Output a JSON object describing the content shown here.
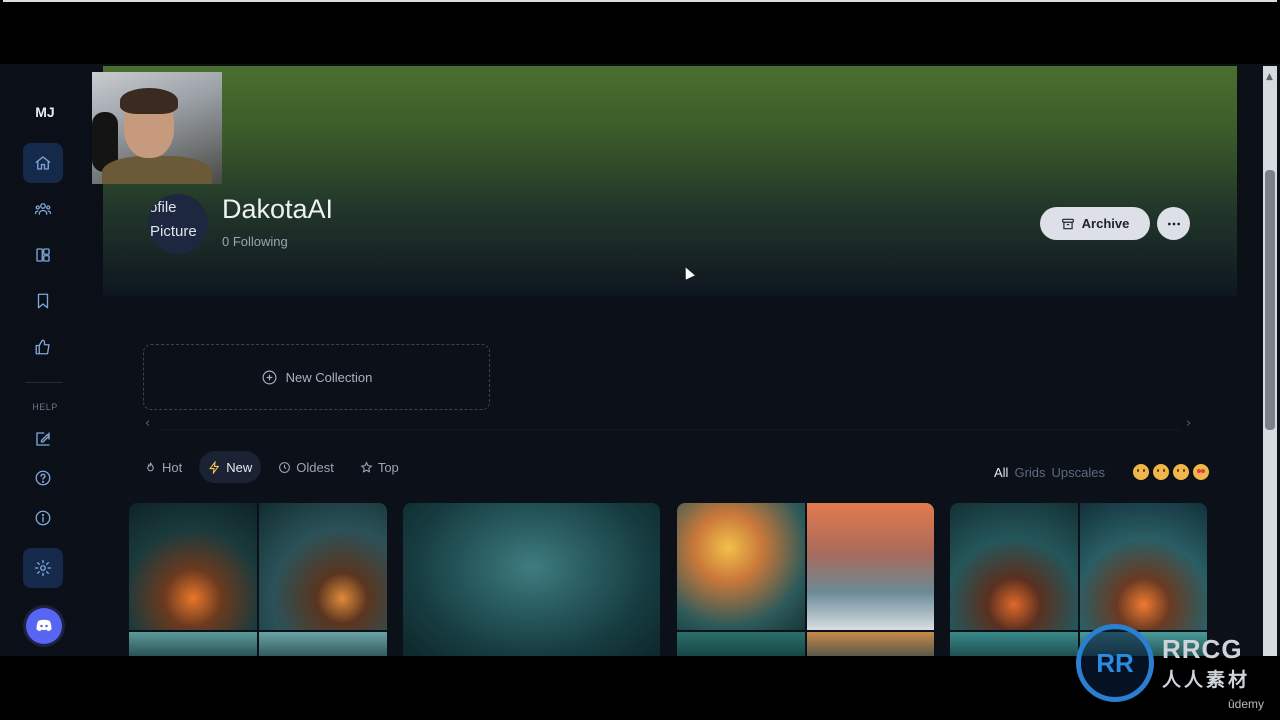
{
  "sidebar": {
    "logo": "MJ",
    "help_label": "HELP",
    "nav_items": [
      {
        "icon": "home-icon",
        "active": true
      },
      {
        "icon": "community-icon"
      },
      {
        "icon": "layout-icon"
      },
      {
        "icon": "bookmark-icon"
      },
      {
        "icon": "thumbs-up-icon"
      }
    ],
    "help_items": [
      {
        "icon": "edit-icon"
      },
      {
        "icon": "help-icon"
      },
      {
        "icon": "info-icon"
      },
      {
        "icon": "settings-icon"
      }
    ],
    "discord_icon": "discord-icon"
  },
  "profile": {
    "avatar_text_line1": "rofile",
    "avatar_text_line2": "Picture",
    "username": "DakotaAI",
    "following": "0 Following",
    "archive_label": "Archive"
  },
  "collections": {
    "new_collection_label": "New Collection"
  },
  "filters": {
    "sort_options": [
      {
        "label": "Hot",
        "icon": "fire-icon"
      },
      {
        "label": "New",
        "icon": "bolt-icon",
        "active": true
      },
      {
        "label": "Oldest",
        "icon": "clock-icon"
      },
      {
        "label": "Top",
        "icon": "star-icon"
      }
    ],
    "view_options": [
      "All",
      "Grids",
      "Upscales"
    ],
    "selected_view": "All"
  },
  "watermark": {
    "logo_text": "RR",
    "line1": "RRCG",
    "line2": "人人素材",
    "udemy": "ûdemy"
  },
  "colors": {
    "accent": "#7fa7d9",
    "discord": "#5865f2",
    "banner_top": "#4b6f2e"
  }
}
